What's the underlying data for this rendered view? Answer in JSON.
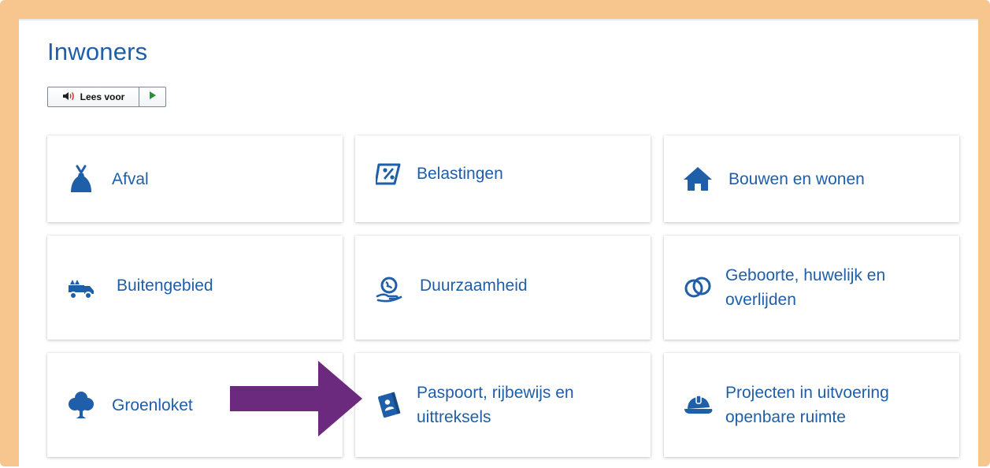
{
  "page": {
    "title": "Inwoners"
  },
  "readspeaker": {
    "listen_label": "Lees voor",
    "speaker_icon": "speaker-icon",
    "play_icon": "play-icon"
  },
  "tiles": [
    {
      "label": "Afval",
      "icon": "waste-bag-icon"
    },
    {
      "label": "Belastingen",
      "icon": "tax-tag-icon"
    },
    {
      "label": "Bouwen en wonen",
      "icon": "house-icon"
    },
    {
      "label": "Buitengebied",
      "icon": "countryside-vehicle-icon"
    },
    {
      "label": "Duurzaamheid",
      "icon": "globe-hand-icon"
    },
    {
      "label": "Geboorte, huwelijk en overlijden",
      "icon": "rings-icon"
    },
    {
      "label": "Groenloket",
      "icon": "tree-icon"
    },
    {
      "label": "Paspoort, rijbewijs en uittreksels",
      "icon": "passport-icon"
    },
    {
      "label": "Projecten in uitvoering openbare ruimte",
      "icon": "hard-hat-icon"
    }
  ],
  "annotation": {
    "icon": "pointer-arrow-icon",
    "color": "#6b2a7d"
  },
  "colors": {
    "accent": "#1f5ea8",
    "frame": "#f7c68f"
  }
}
